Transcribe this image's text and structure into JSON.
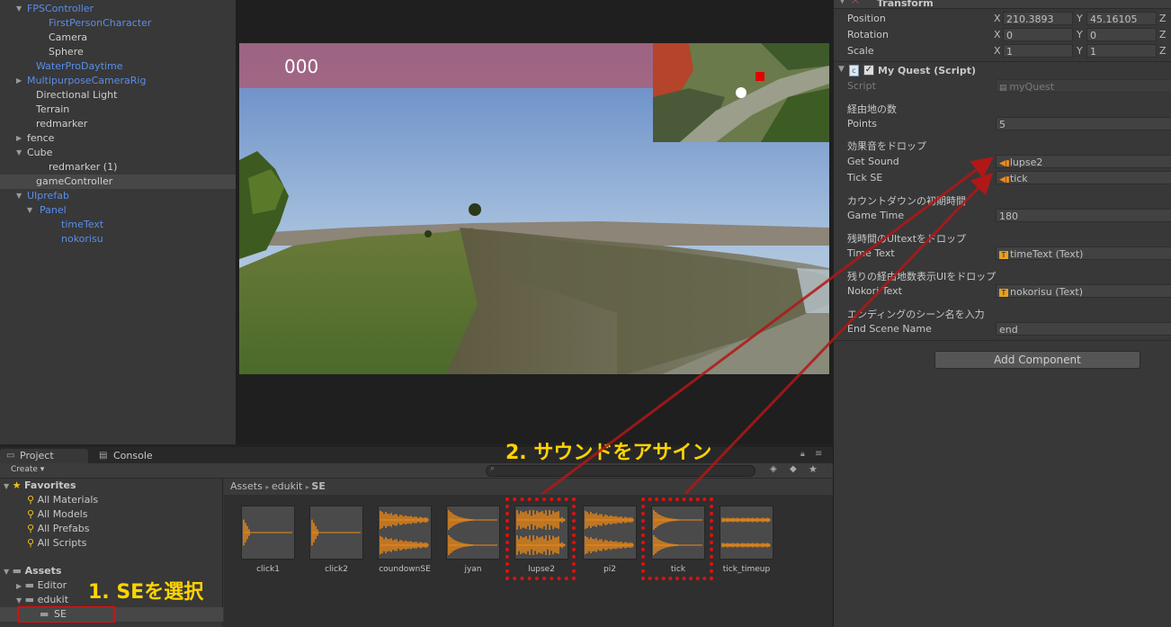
{
  "hierarchy": {
    "items": [
      {
        "label": "FPSController",
        "arrow": "▼",
        "color": "blue"
      },
      {
        "label": "FirstPersonCharacter",
        "arrow": "",
        "color": "blue"
      },
      {
        "label": "Camera",
        "arrow": "",
        "color": "white"
      },
      {
        "label": "Sphere",
        "arrow": "",
        "color": "white"
      },
      {
        "label": "WaterProDaytime",
        "arrow": "",
        "color": "blue"
      },
      {
        "label": "MultipurposeCameraRig",
        "arrow": "▶",
        "color": "blue"
      },
      {
        "label": "Directional Light",
        "arrow": "",
        "color": "white"
      },
      {
        "label": "Terrain",
        "arrow": "",
        "color": "white"
      },
      {
        "label": "redmarker",
        "arrow": "",
        "color": "white"
      },
      {
        "label": "fence",
        "arrow": "▶",
        "color": "white"
      },
      {
        "label": "Cube",
        "arrow": "▼",
        "color": "white"
      },
      {
        "label": "redmarker (1)",
        "arrow": "",
        "color": "white"
      },
      {
        "label": "gameController",
        "arrow": "",
        "color": "white",
        "selected": true
      },
      {
        "label": "UIprefab",
        "arrow": "▼",
        "color": "blue"
      },
      {
        "label": "Panel",
        "arrow": "▼",
        "color": "blue"
      },
      {
        "label": "timeText",
        "arrow": "",
        "color": "blue"
      },
      {
        "label": "nokorisu",
        "arrow": "",
        "color": "blue"
      }
    ]
  },
  "game": {
    "counter": "000"
  },
  "inspector": {
    "transform": {
      "title": "Transform",
      "position_label": "Position",
      "position": {
        "x": "210.3893",
        "y": "45.16105",
        "z": ""
      },
      "rotation_label": "Rotation",
      "rotation": {
        "x": "0",
        "y": "0",
        "z": ""
      },
      "scale_label": "Scale",
      "scale": {
        "x": "1",
        "y": "1",
        "z": ""
      },
      "axis_x": "X",
      "axis_y": "Y",
      "axis_z": "Z"
    },
    "component": {
      "title": "My Quest (Script)",
      "script_label": "Script",
      "script_value": "myQuest",
      "waypoints_header": "経由地の数",
      "points_label": "Points",
      "points_value": "5",
      "sound_header": "効果音をドロップ",
      "get_sound_label": "Get Sound",
      "get_sound_value": "lupse2",
      "tick_se_label": "Tick SE",
      "tick_se_value": "tick",
      "countdown_header": "カウントダウンの初期時間",
      "game_time_label": "Game Time",
      "game_time_value": "180",
      "time_ui_header": "残時間のUItextをドロップ",
      "time_text_label": "Time Text",
      "time_text_value": "timeText (Text)",
      "nokori_header": "残りの経由地数表示UIをドロップ",
      "nokori_label": "Nokori Text",
      "nokori_value": "nokorisu (Text)",
      "ending_header": "エンディングのシーン名を入力",
      "end_scene_label": "End Scene Name",
      "end_scene_value": "end"
    },
    "add_component": "Add Component"
  },
  "project": {
    "tab_project": "Project",
    "tab_console": "Console",
    "create": "Create ▾",
    "favorites": "Favorites",
    "fav_items": [
      "All Materials",
      "All Models",
      "All Prefabs",
      "All Scripts"
    ],
    "assets": "Assets",
    "folders": [
      "Editor",
      "edukit",
      "SE"
    ],
    "breadcrumb": [
      "Assets",
      "edukit",
      "SE"
    ],
    "files": [
      "click1",
      "click2",
      "coundownSE",
      "jyan",
      "lupse2",
      "pi2",
      "tick",
      "tick_timeup"
    ]
  },
  "annotations": {
    "step1": "1. SEを選択",
    "step2": "2. サウンドをアサイン"
  },
  "colors": {
    "accent_orange": "#f08a14",
    "annotation_yellow": "#ffd400",
    "highlight_red": "#e01010"
  }
}
